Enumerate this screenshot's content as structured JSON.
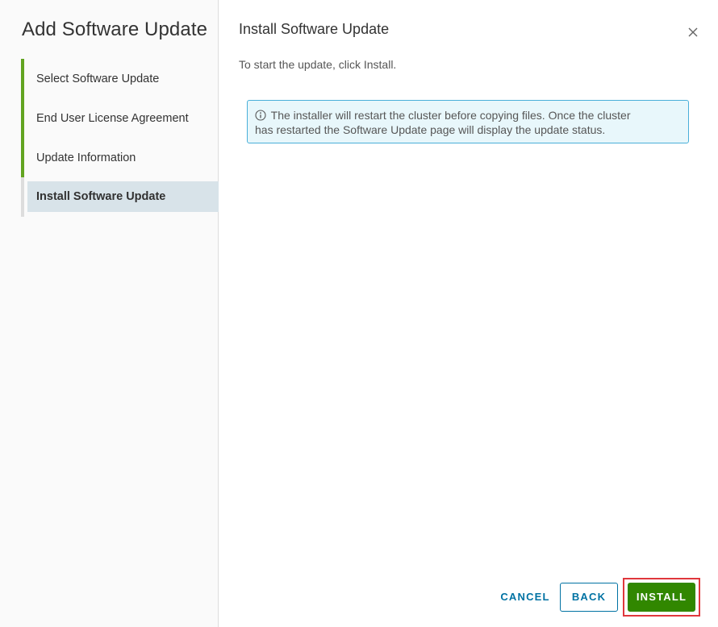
{
  "wizard": {
    "title": "Add Software Update",
    "steps": [
      {
        "label": "Select Software Update",
        "status": "complete"
      },
      {
        "label": "End User License Agreement",
        "status": "complete"
      },
      {
        "label": "Update Information",
        "status": "complete"
      },
      {
        "label": "Install Software Update",
        "status": "current"
      }
    ]
  },
  "main": {
    "title": "Install Software Update",
    "instructions": "To start the update, click Install.",
    "alert": {
      "icon": "info-circle-icon",
      "line1": "The installer will restart the cluster before copying files. Once the cluster",
      "line2": "has restarted the Software Update page will display the update status."
    }
  },
  "footer": {
    "cancel_label": "CANCEL",
    "back_label": "BACK",
    "install_label": "INSTALL"
  },
  "colors": {
    "accent_green": "#318700",
    "step_complete": "#62a420",
    "link_blue": "#0072a3",
    "alert_border": "#49afd9",
    "alert_bg": "#e8f7fb",
    "highlight_red": "#e0373c"
  }
}
